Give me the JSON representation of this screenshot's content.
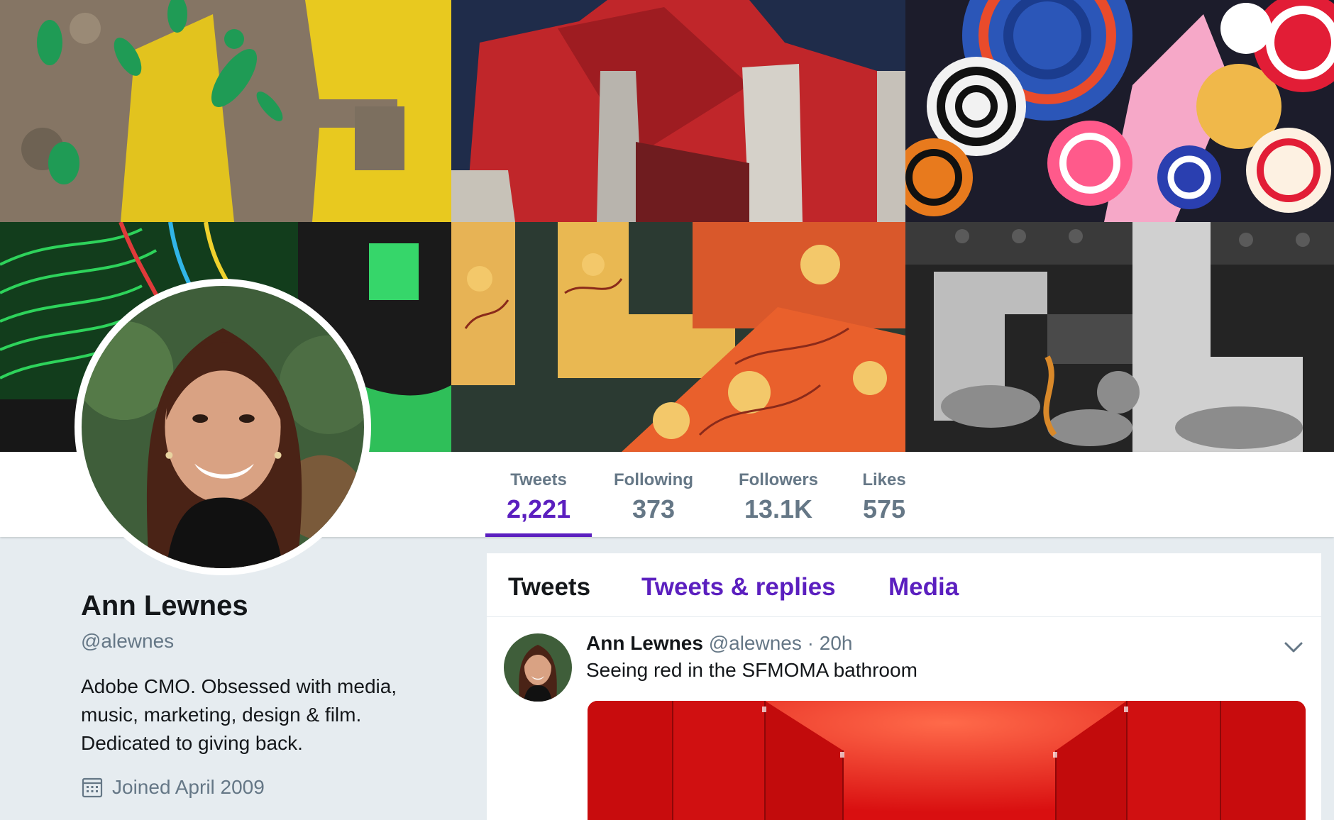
{
  "profile": {
    "name": "Ann Lewnes",
    "handle": "@alewnes",
    "bio": "Adobe CMO. Obsessed with media, music, marketing, design & film. Dedicated to giving back.",
    "joined": "Joined April 2009",
    "joined_icon": "calendar-icon"
  },
  "stats": [
    {
      "label": "Tweets",
      "value": "2,221",
      "active": true
    },
    {
      "label": "Following",
      "value": "373",
      "active": false
    },
    {
      "label": "Followers",
      "value": "13.1K",
      "active": false
    },
    {
      "label": "Likes",
      "value": "575",
      "active": false
    }
  ],
  "tabs": [
    {
      "label": "Tweets",
      "active": true
    },
    {
      "label": "Tweets & replies",
      "active": false
    },
    {
      "label": "Media",
      "active": false
    }
  ],
  "tweet": {
    "name": "Ann Lewnes",
    "handle": "@alewnes",
    "separator": "·",
    "time": "20h",
    "text": "Seeing red in the SFMOMA bathroom",
    "menu_icon": "chevron-down-icon"
  },
  "colors": {
    "accent": "#5b1fbf",
    "text": "#14171a",
    "muted": "#657786",
    "page_background": "#e6ecf0"
  }
}
